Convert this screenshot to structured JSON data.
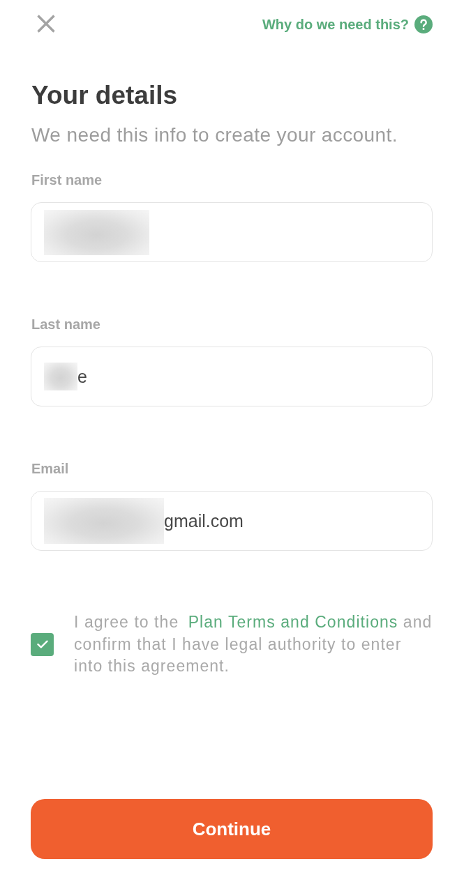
{
  "help_link": {
    "label": "Why do we need this?"
  },
  "title": "Your details",
  "subtitle": "We need this info to create your account.",
  "fields": [
    {
      "label": "First name",
      "blurred": true
    },
    {
      "label": "Last name",
      "value": "e",
      "blurred": true
    },
    {
      "label": "Email",
      "value": "gmail.com",
      "blurred": true
    }
  ],
  "agreement": {
    "checked": true,
    "text_before": "I agree to the",
    "link": "Plan Terms and Conditions",
    "text_after": "and confirm that I have legal authority to enter into this agreement."
  },
  "primary_button": {
    "label": "Continue"
  }
}
